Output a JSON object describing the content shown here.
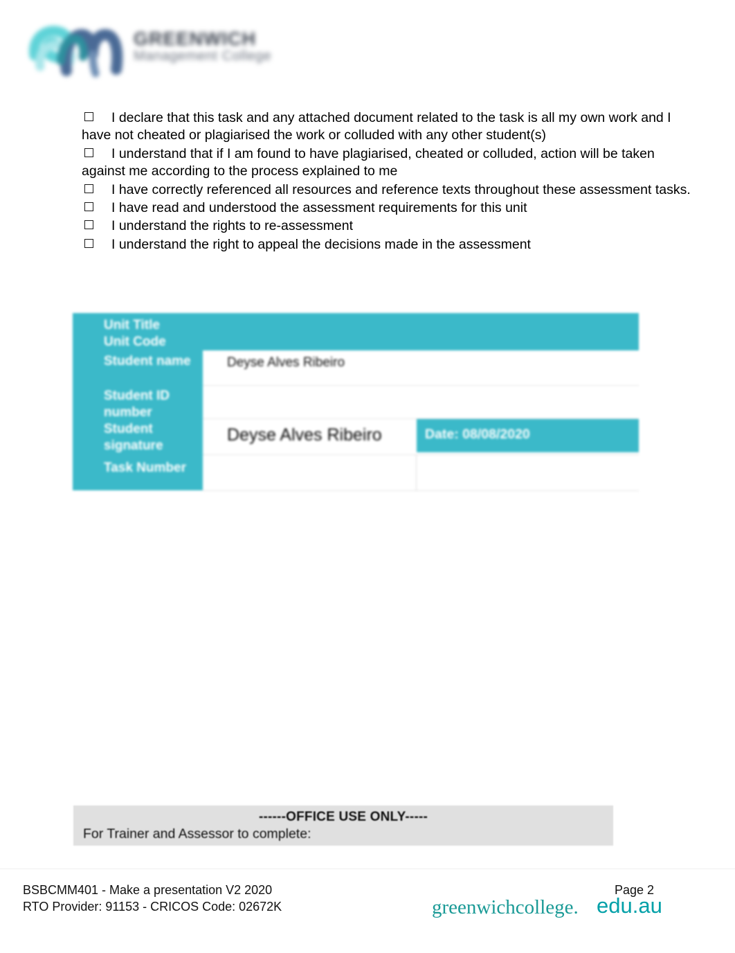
{
  "header": {
    "logo_icon": "greenwich-swirl-logo-icon",
    "college_name": "GREENWICH",
    "college_subtitle": "Management College"
  },
  "declaration": {
    "checkbox_icon": "empty-checkbox-icon",
    "items": [
      "I declare that this task and any attached document related to the task is all my own work and I have not cheated or plagiarised the work or colluded with any other student(s)",
      "I understand that if I am found to have plagiarised, cheated or colluded, action will be taken against me according to the process explained to me",
      "I have correctly referenced all resources and reference texts throughout these assessment tasks.",
      "I have read and understood the assessment requirements for this unit",
      "I understand the rights to re-assessment",
      "I understand the right to appeal the decisions made in the assessment"
    ]
  },
  "info_table": {
    "labels": {
      "unit_title": "Unit Title",
      "unit_code": "Unit Code",
      "student_name": "Student name",
      "student_id": "Student ID number",
      "student_signature": "Student signature",
      "task_number": "Task Number"
    },
    "values": {
      "unit_title": "",
      "unit_code": "",
      "student_name": "Deyse Alves Ribeiro",
      "student_id": "",
      "student_signature": "Deyse Alves Ribeiro",
      "date": "Date: 08/08/2020",
      "task_number": "",
      "task_number_second": ""
    },
    "accent_color": "#3bb9c9"
  },
  "office_use": {
    "title": "------OFFICE USE ONLY-----",
    "subtitle": "For Trainer and Assessor to complete:",
    "background_color": "#e0e0e0"
  },
  "footer": {
    "unit_line": "BSBCMM401 - Make a presentation V2 2020",
    "rto_line": "RTO Provider: 91153  - CRICOS  Code: 02672K",
    "page_label": "Page 2",
    "brand": "greenwichcollege.",
    "domain": "edu.au",
    "brand_color": "#1a9a96"
  }
}
